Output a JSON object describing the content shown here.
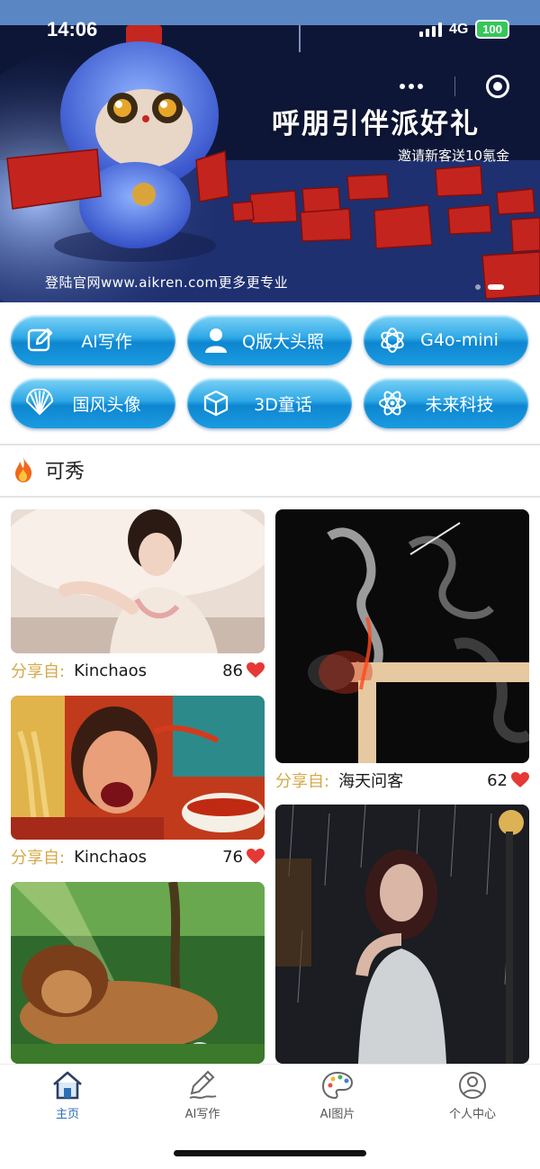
{
  "status_bar": {
    "time": "14:06",
    "network": "4G",
    "battery": "100"
  },
  "banner": {
    "title": "呼朋引伴派好礼",
    "subtitle": "邀请新客送10氪金",
    "footer": "登陆官网www.aikren.com更多更专业",
    "slide_count": 2,
    "active_slide": 2
  },
  "quick_actions": [
    {
      "label": "AI写作",
      "icon": "edit-icon"
    },
    {
      "label": "Q版大头照",
      "icon": "person-icon"
    },
    {
      "label": "G4o-mini",
      "icon": "openai-icon"
    },
    {
      "label": "国风头像",
      "icon": "fan-icon"
    },
    {
      "label": "3D童话",
      "icon": "cube-icon"
    },
    {
      "label": "未来科技",
      "icon": "atom-icon"
    }
  ],
  "section": {
    "title": "可秀",
    "icon": "fire-icon"
  },
  "feed": {
    "share_prefix": "分享自:",
    "items": [
      {
        "user": "Kinchaos",
        "likes": "86",
        "image": "woman-qipao-illustration"
      },
      {
        "user": "海天问客",
        "likes": "62",
        "image": "smoke-violinist-match"
      },
      {
        "user": "Kinchaos",
        "likes": "76",
        "image": "spicy-noodle-face"
      },
      {
        "user": "",
        "likes": "",
        "image": "sleeping-lion-jungle"
      },
      {
        "user": "",
        "likes": "",
        "image": "woman-in-rain-street"
      }
    ]
  },
  "tab_bar": {
    "tabs": [
      {
        "label": "主页",
        "icon": "home-icon",
        "active": true
      },
      {
        "label": "AI写作",
        "icon": "pen-icon",
        "active": false
      },
      {
        "label": "AI图片",
        "icon": "palette-icon",
        "active": false
      },
      {
        "label": "个人中心",
        "icon": "user-icon",
        "active": false
      }
    ]
  },
  "colors": {
    "accent": "#2b6fb7",
    "button_blue": "#1a9be0",
    "share_prefix": "#d4a94a",
    "heart": "#e53935"
  }
}
